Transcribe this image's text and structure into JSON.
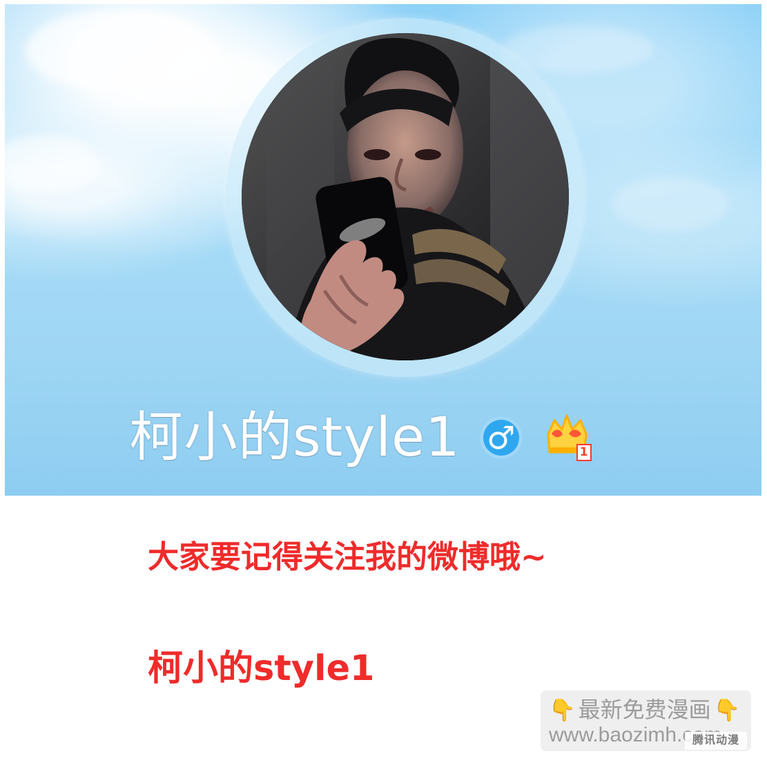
{
  "profile": {
    "name": "柯小的style1",
    "gender_symbol": "♂",
    "rank_badge_number": "1"
  },
  "message": {
    "follow_text": "大家要记得关注我的微博哦~",
    "account_name": "柯小的style1"
  },
  "watermark": {
    "left_icon": "👇",
    "title": "最新免费漫画",
    "right_icon": "👇",
    "url": "www.baozimh.com",
    "corner_mark": "腾讯动漫"
  },
  "icons": {
    "male": "male-icon",
    "crown": "crown-icon",
    "pointing-down": "pointing-down-icon"
  },
  "colors": {
    "sky": "#a9ddf8",
    "male_badge": "#2fa7ef",
    "message_red": "#ef2b2b",
    "watermark_gray": "#9b9b9b"
  }
}
